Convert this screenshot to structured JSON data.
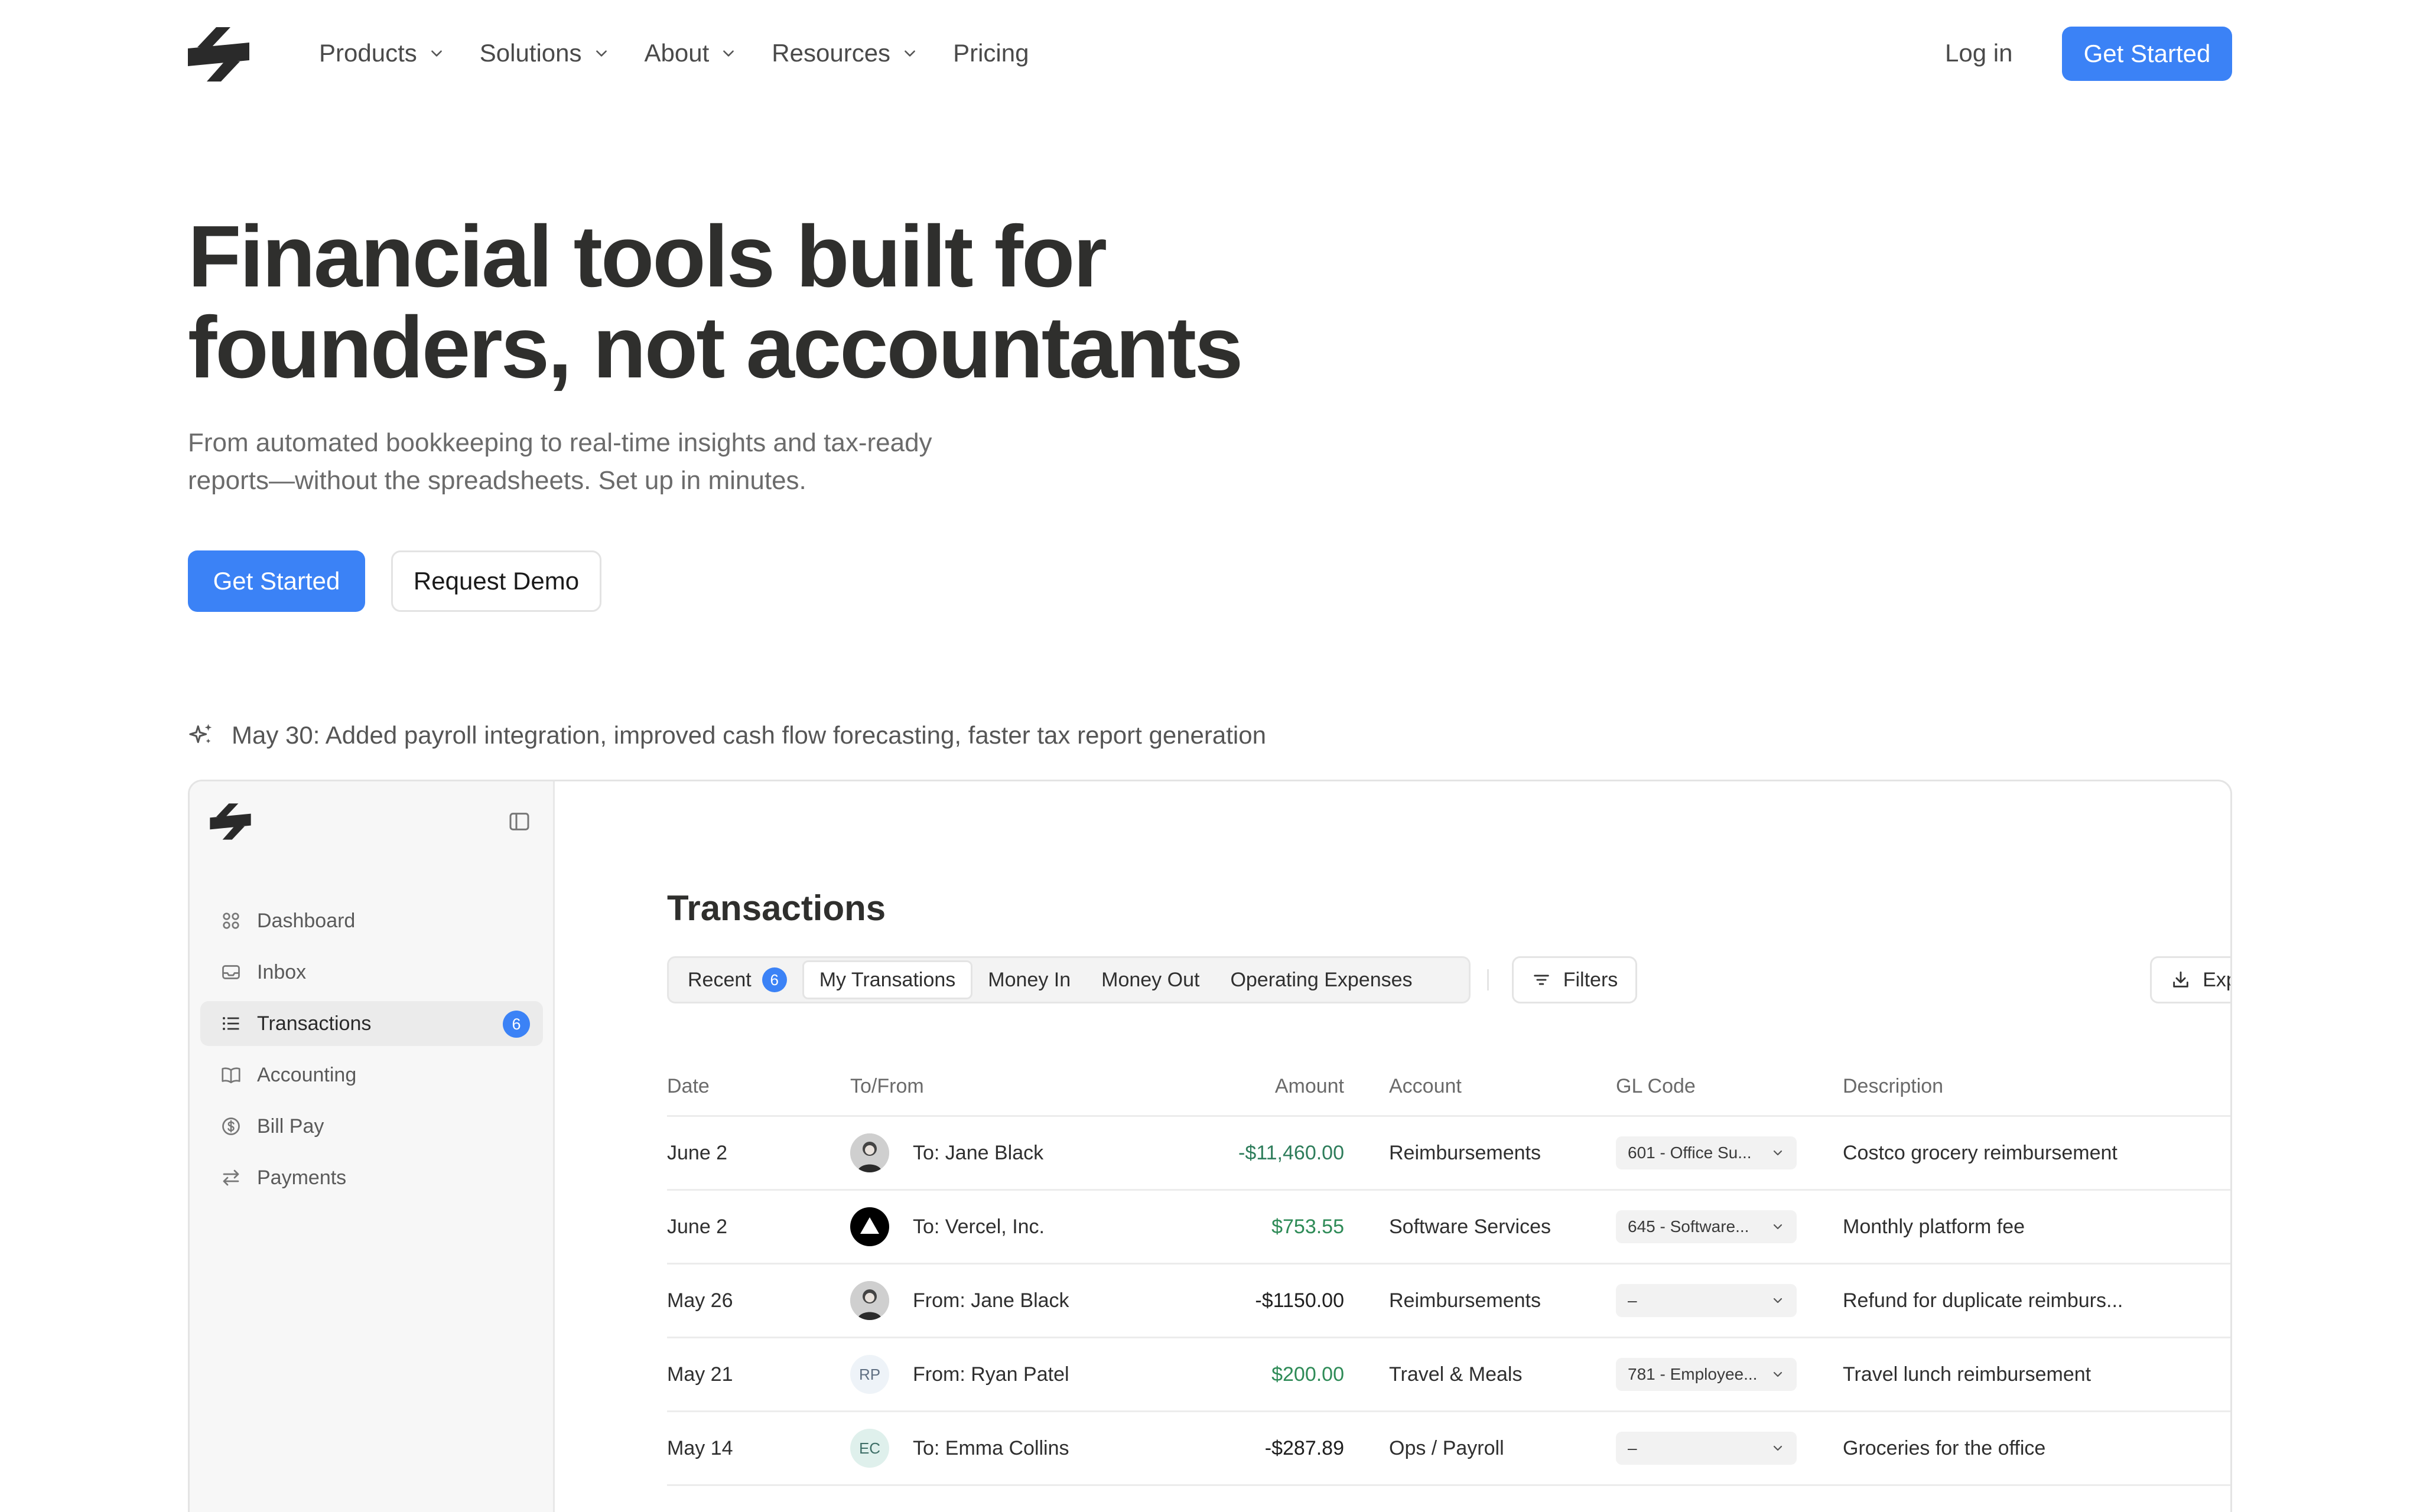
{
  "nav": {
    "links": [
      "Products",
      "Solutions",
      "About",
      "Resources"
    ],
    "pricing": "Pricing",
    "login": "Log in",
    "cta": "Get Started"
  },
  "hero": {
    "title_line1": "Financial tools built for",
    "title_line2": "founders, not accountants",
    "subtitle_line1": "From automated bookkeeping to real-time insights and tax-ready",
    "subtitle_line2": "reports—without the spreadsheets. Set up in minutes.",
    "primary_cta": "Get Started",
    "secondary_cta": "Request Demo"
  },
  "announcement": "May 30: Added payroll integration, improved cash flow forecasting, faster tax report generation",
  "app": {
    "sidebar": {
      "items": [
        {
          "label": "Dashboard",
          "icon": "dashboard-icon"
        },
        {
          "label": "Inbox",
          "icon": "inbox-icon"
        },
        {
          "label": "Transactions",
          "icon": "list-icon",
          "badge": "6",
          "active": true
        },
        {
          "label": "Accounting",
          "icon": "book-icon"
        },
        {
          "label": "Bill Pay",
          "icon": "dollar-icon"
        },
        {
          "label": "Payments",
          "icon": "arrows-icon"
        }
      ]
    },
    "title": "Transactions",
    "tabs": [
      {
        "label": "Recent",
        "badge": "6"
      },
      {
        "label": "My Transations"
      },
      {
        "label": "Money In"
      },
      {
        "label": "Money Out"
      },
      {
        "label": "Operating Expenses"
      }
    ],
    "filters_label": "Filters",
    "export_label": "Export All",
    "columns": [
      "Date",
      "To/From",
      "Amount",
      "Account",
      "GL Code",
      "Description"
    ],
    "rows": [
      {
        "date": "June 2",
        "to": "To: Jane Black",
        "amount": "-$11,460.00",
        "amount_color": "#2e7d5b",
        "account": "Reimbursements",
        "gl": "601 - Office Su...",
        "desc": "Costco grocery reimbursement",
        "avatar": "photo"
      },
      {
        "date": "June 2",
        "to": "To: Vercel, Inc.",
        "amount": "$753.55",
        "amount_color": "#2e8b57",
        "account": "Software Services",
        "gl": "645 - Software...",
        "desc": "Monthly platform fee",
        "avatar": "vercel"
      },
      {
        "date": "May 26",
        "to": "From: Jane Black",
        "amount": "-$1150.00",
        "amount_color": "#1f1f1f",
        "account": "Reimbursements",
        "gl": "–",
        "desc": "Refund for duplicate reimburs...",
        "avatar": "photo"
      },
      {
        "date": "May 21",
        "to": "From: Ryan Patel",
        "amount": "$200.00",
        "amount_color": "#2e8b57",
        "account": "Travel & Meals",
        "gl": "781 - Employee...",
        "desc": "Travel lunch reimbursement",
        "avatar": "RP"
      },
      {
        "date": "May 14",
        "to": "To: Emma Collins",
        "amount": "-$287.89",
        "amount_color": "#1f1f1f",
        "account": "Ops / Payroll",
        "gl": "–",
        "desc": "Groceries for the office",
        "avatar": "EC"
      }
    ]
  },
  "colors": {
    "accent": "#3b82f6",
    "positive": "#2e8b57",
    "text": "#2f2f2d"
  }
}
